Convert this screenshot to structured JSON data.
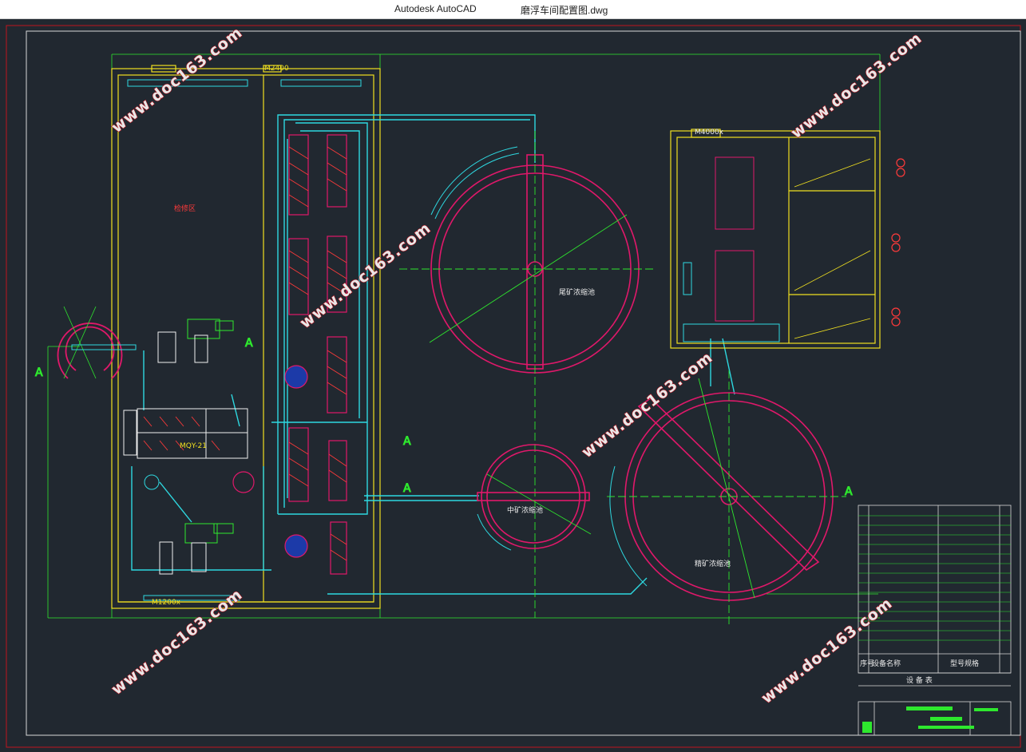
{
  "window": {
    "app_name": "Autodesk AutoCAD",
    "file_name": "磨浮车间配置图.dwg"
  },
  "drawing": {
    "areas": {
      "maintenance": "检修区",
      "tailings_thickener": "尾矿浓缩池",
      "middlings_thickener": "中矿浓缩池",
      "concentrate_thickener": "精矿浓缩池"
    },
    "section_marks": [
      "A",
      "A",
      "A",
      "A",
      "A"
    ],
    "crane_labels": {
      "top_bay": "M2400",
      "right_bay": "M4000x",
      "bottom_bay": "M1200x"
    },
    "mill_label": "MQY-21",
    "equipment_table": {
      "title": "设 备 表",
      "header": {
        "seq": "序号",
        "name": "设备名称",
        "spec": "型号规格"
      }
    }
  },
  "watermarks": [
    "www.doc163.com",
    "www.doc163.com",
    "www.doc163.com",
    "www.doc163.com",
    "www.doc163.com",
    "www.doc163.com"
  ],
  "colors": {
    "background": "#212830",
    "frame": "#d8d8d8",
    "border_red": "#c0141e",
    "building_yellow": "#f0e020",
    "equipment_red": "#e0186a",
    "pipe_cyan": "#2ed8e0",
    "line_green": "#2ee82e",
    "watermark_text": "#e8e8e8",
    "watermark_outline": "#c0141e"
  }
}
